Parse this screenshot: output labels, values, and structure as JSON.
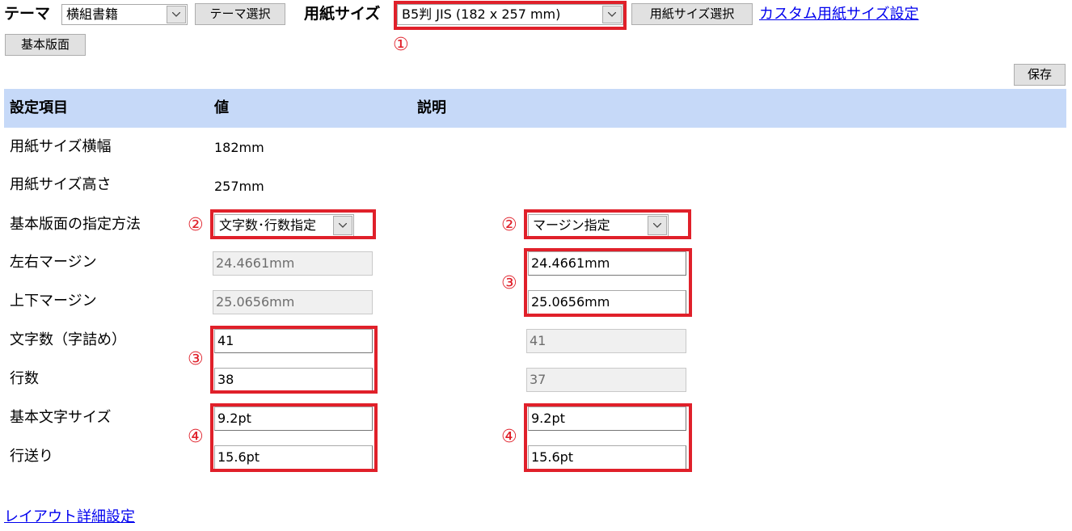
{
  "toolbar": {
    "theme_label": "テーマ",
    "theme_value": "横組書籍",
    "theme_button": "テーマ選択",
    "paper_label": "用紙サイズ",
    "paper_value": "B5判 JIS (182 x 257 mm)",
    "paper_button": "用紙サイズ選択",
    "custom_link": "カスタム用紙サイズ設定",
    "base_button": "基本版面",
    "save_button": "保存"
  },
  "table": {
    "headers": [
      "設定項目",
      "値",
      "説明"
    ],
    "rows": {
      "width_label": "用紙サイズ横幅",
      "width_value": "182mm",
      "height_label": "用紙サイズ高さ",
      "height_value": "257mm",
      "method_label": "基本版面の指定方法",
      "method_left": "文字数･行数指定",
      "method_right": "マージン指定",
      "lr_margin_label": "左右マージン",
      "lr_margin_left": "24.4661mm",
      "lr_margin_right": "24.4661mm",
      "tb_margin_label": "上下マージン",
      "tb_margin_left": "25.0656mm",
      "tb_margin_right": "25.0656mm",
      "chars_label": "文字数（字詰め）",
      "chars_left": "41",
      "chars_right": "41",
      "lines_label": "行数",
      "lines_left": "38",
      "lines_right": "37",
      "font_size_label": "基本文字サイズ",
      "font_size_left": "9.2pt",
      "font_size_right": "9.2pt",
      "leading_label": "行送り",
      "leading_left": "15.6pt",
      "leading_right": "15.6pt"
    }
  },
  "annotations": {
    "n1": "①",
    "n2": "②",
    "n3": "③",
    "n4": "④",
    "color": "#e0202a"
  },
  "footer_link": "レイアウト詳細設定"
}
